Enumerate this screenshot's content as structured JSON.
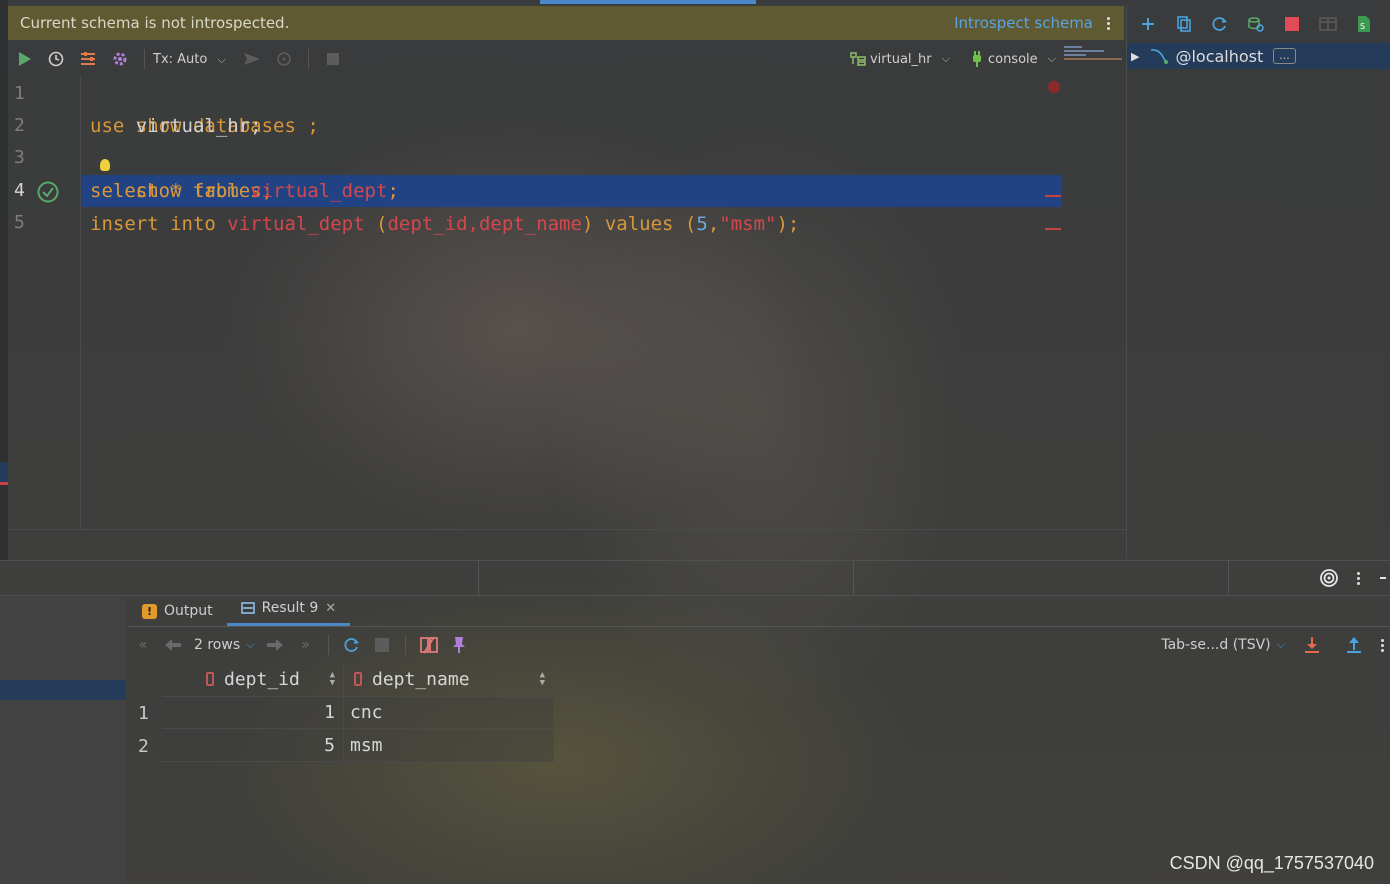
{
  "banner": {
    "message": "Current schema is not introspected.",
    "action": "Introspect schema"
  },
  "editor_toolbar": {
    "tx_label": "Tx: Auto",
    "schema": "virtual_hr",
    "session": "console"
  },
  "editor": {
    "line_numbers": [
      "1",
      "2",
      "3",
      "4",
      "5"
    ],
    "lines": {
      "l1": {
        "kw": "show databases ;"
      },
      "l2": {
        "kw": "use",
        "id": " virtual_hr;"
      },
      "l3": {
        "kw": "show tables;"
      },
      "l4": {
        "kw1": "select * from",
        "tbl": "virtual_dept",
        "end": ";"
      },
      "l5": {
        "kw1": "insert into",
        "tbl": "virtual_dept",
        "p1": " (",
        "cols": "dept_id,dept_name",
        "p2": ") ",
        "kw2": "values",
        "p3": " (",
        "num": "5",
        "comma": ",",
        "str": "\"msm\"",
        "end": ");"
      }
    }
  },
  "db_panel": {
    "connection": "@localhost",
    "more": "..."
  },
  "result_tabs": [
    {
      "label": "Output"
    },
    {
      "label": "Result 9"
    }
  ],
  "result_toolbar": {
    "rows": "2 rows",
    "export_format": "Tab-se...d (TSV)"
  },
  "grid": {
    "columns": [
      "dept_id",
      "dept_name"
    ],
    "rows": [
      {
        "num": "1",
        "dept_id": "1",
        "dept_name": "cnc"
      },
      {
        "num": "2",
        "dept_id": "5",
        "dept_name": "msm"
      }
    ]
  },
  "watermark": "CSDN @qq_1757537040",
  "colors": {
    "keyword": "#d99738",
    "table_ref": "#d4484d",
    "number": "#6fa9dc",
    "selection": "#214283",
    "banner": "#666030",
    "link": "#5aa3e0"
  },
  "icons": [
    "run-icon",
    "history-icon",
    "settings-icon",
    "gear-icon",
    "commit-icon",
    "rollback-icon",
    "stop-icon",
    "schema-icon",
    "console-plug-icon",
    "add-icon",
    "copy-icon",
    "refresh-icon",
    "filter-icon",
    "stop-icon",
    "table-icon",
    "ddl-icon",
    "target-icon",
    "more-icon",
    "first-page-icon",
    "prev-page-icon",
    "next-page-icon",
    "last-page-icon",
    "reload-icon",
    "compare-icon",
    "pin-icon",
    "download-icon",
    "upload-icon",
    "key-icon",
    "warning-icon"
  ]
}
